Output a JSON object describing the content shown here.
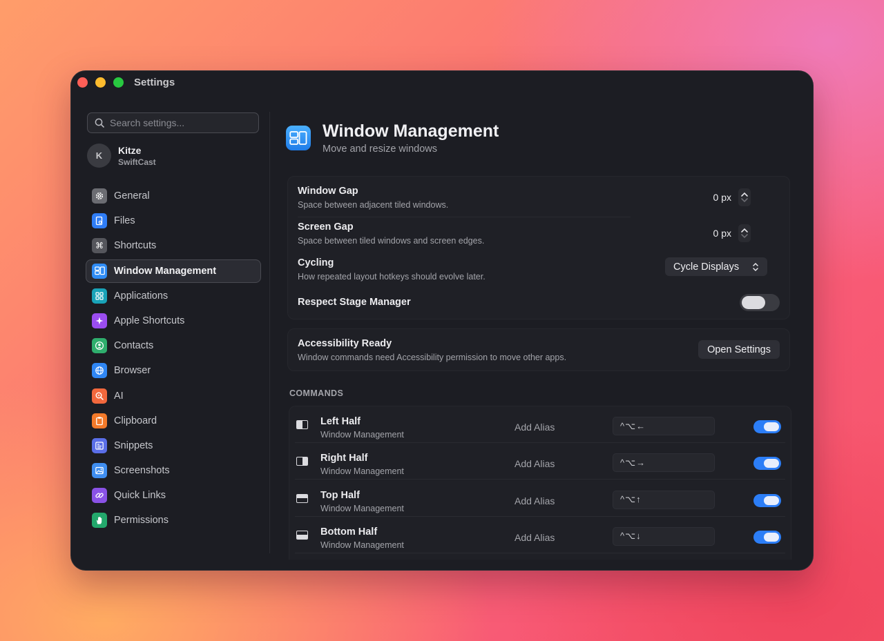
{
  "window": {
    "title": "Settings"
  },
  "search": {
    "placeholder": "Search settings..."
  },
  "profile": {
    "initial": "K",
    "name": "Kitze",
    "subtitle": "SwiftCast"
  },
  "sidebar": {
    "items": [
      {
        "label": "General",
        "icon": "gear-icon",
        "color": "#6b6c72"
      },
      {
        "label": "Files",
        "icon": "file-search-icon",
        "color": "#2f7df6"
      },
      {
        "label": "Shortcuts",
        "icon": "command-icon",
        "color": "#55565c"
      },
      {
        "label": "Window Management",
        "icon": "window-layout-icon",
        "color": "#2f8cf5",
        "active": true
      },
      {
        "label": "Applications",
        "icon": "grid-icon",
        "color": "#19a3b8"
      },
      {
        "label": "Apple Shortcuts",
        "icon": "sparkle-icon",
        "color": "#9b4df0"
      },
      {
        "label": "Contacts",
        "icon": "person-icon",
        "color": "#2fae6d"
      },
      {
        "label": "Browser",
        "icon": "globe-icon",
        "color": "#2f86f3"
      },
      {
        "label": "AI",
        "icon": "ai-search-icon",
        "color": "#f2683d"
      },
      {
        "label": "Clipboard",
        "icon": "clipboard-icon",
        "color": "#f37a2a"
      },
      {
        "label": "Snippets",
        "icon": "text-snippet-icon",
        "color": "#5a6ee8"
      },
      {
        "label": "Screenshots",
        "icon": "image-icon",
        "color": "#3f8ef0"
      },
      {
        "label": "Quick Links",
        "icon": "link-icon",
        "color": "#8a52e6"
      },
      {
        "label": "Permissions",
        "icon": "hand-icon",
        "color": "#23a86c"
      }
    ]
  },
  "header": {
    "title": "Window Management",
    "subtitle": "Move and resize windows",
    "icon": "window-layout-icon"
  },
  "settings": {
    "window_gap": {
      "title": "Window Gap",
      "desc": "Space between adjacent tiled windows.",
      "value": "0 px"
    },
    "screen_gap": {
      "title": "Screen Gap",
      "desc": "Space between tiled windows and screen edges.",
      "value": "0 px"
    },
    "cycling": {
      "title": "Cycling",
      "desc": "How repeated layout hotkeys should evolve later.",
      "value": "Cycle Displays"
    },
    "stage_manager": {
      "title": "Respect Stage Manager",
      "enabled": false
    }
  },
  "accessibility": {
    "title": "Accessibility Ready",
    "desc": "Window commands need Accessibility permission to move other apps.",
    "button": "Open Settings"
  },
  "commands": {
    "section_title": "COMMANDS",
    "items": [
      {
        "title": "Left Half",
        "subtitle": "Window Management",
        "alias": "Add Alias",
        "hotkey": "^⌥←",
        "enabled": true,
        "icon": "left-half-icon"
      },
      {
        "title": "Right Half",
        "subtitle": "Window Management",
        "alias": "Add Alias",
        "hotkey": "^⌥→",
        "enabled": true,
        "icon": "right-half-icon"
      },
      {
        "title": "Top Half",
        "subtitle": "Window Management",
        "alias": "Add Alias",
        "hotkey": "^⌥↑",
        "enabled": true,
        "icon": "top-half-icon"
      },
      {
        "title": "Bottom Half",
        "subtitle": "Window Management",
        "alias": "Add Alias",
        "hotkey": "^⌥↓",
        "enabled": true,
        "icon": "bottom-half-icon"
      }
    ]
  }
}
